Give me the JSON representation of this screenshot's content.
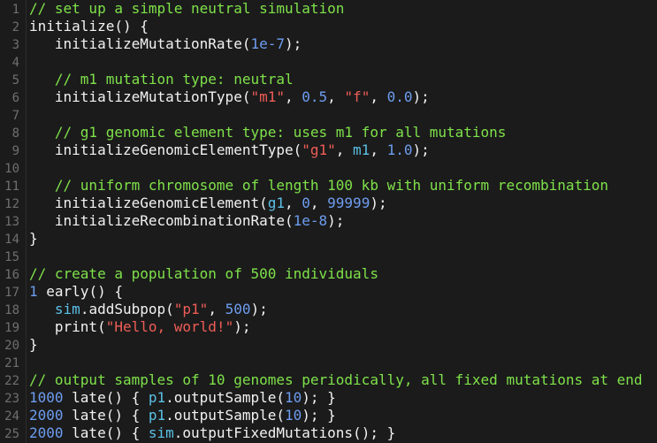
{
  "colors": {
    "background": "#1b1b1b",
    "line_number": "#6f6f6f",
    "plain": "#f2f2f2",
    "comment": "#7fe24a",
    "number": "#6d9df0",
    "string": "#ef5d57",
    "identifier": "#5bc1e6"
  },
  "editor": {
    "lines": [
      {
        "n": "1",
        "tokens": [
          {
            "t": "comment",
            "v": "// set up a simple neutral simulation"
          }
        ]
      },
      {
        "n": "2",
        "tokens": [
          {
            "t": "plain",
            "v": "initialize() {"
          }
        ]
      },
      {
        "n": "3",
        "tokens": [
          {
            "t": "plain",
            "v": "   initializeMutationRate("
          },
          {
            "t": "number",
            "v": "1e-7"
          },
          {
            "t": "plain",
            "v": ");"
          }
        ]
      },
      {
        "n": "4",
        "tokens": []
      },
      {
        "n": "5",
        "tokens": [
          {
            "t": "comment",
            "v": "   // m1 mutation type: neutral"
          }
        ]
      },
      {
        "n": "6",
        "tokens": [
          {
            "t": "plain",
            "v": "   initializeMutationType("
          },
          {
            "t": "string",
            "v": "\"m1\""
          },
          {
            "t": "plain",
            "v": ", "
          },
          {
            "t": "number",
            "v": "0.5"
          },
          {
            "t": "plain",
            "v": ", "
          },
          {
            "t": "string",
            "v": "\"f\""
          },
          {
            "t": "plain",
            "v": ", "
          },
          {
            "t": "number",
            "v": "0.0"
          },
          {
            "t": "plain",
            "v": ");"
          }
        ]
      },
      {
        "n": "7",
        "tokens": []
      },
      {
        "n": "8",
        "tokens": [
          {
            "t": "comment",
            "v": "   // g1 genomic element type: uses m1 for all mutations"
          }
        ]
      },
      {
        "n": "9",
        "tokens": [
          {
            "t": "plain",
            "v": "   initializeGenomicElementType("
          },
          {
            "t": "string",
            "v": "\"g1\""
          },
          {
            "t": "plain",
            "v": ", "
          },
          {
            "t": "ident",
            "v": "m1"
          },
          {
            "t": "plain",
            "v": ", "
          },
          {
            "t": "number",
            "v": "1.0"
          },
          {
            "t": "plain",
            "v": ");"
          }
        ]
      },
      {
        "n": "10",
        "tokens": []
      },
      {
        "n": "11",
        "tokens": [
          {
            "t": "comment",
            "v": "   // uniform chromosome of length 100 kb with uniform recombination"
          }
        ]
      },
      {
        "n": "12",
        "tokens": [
          {
            "t": "plain",
            "v": "   initializeGenomicElement("
          },
          {
            "t": "ident",
            "v": "g1"
          },
          {
            "t": "plain",
            "v": ", "
          },
          {
            "t": "number",
            "v": "0"
          },
          {
            "t": "plain",
            "v": ", "
          },
          {
            "t": "number",
            "v": "99999"
          },
          {
            "t": "plain",
            "v": ");"
          }
        ]
      },
      {
        "n": "13",
        "tokens": [
          {
            "t": "plain",
            "v": "   initializeRecombinationRate("
          },
          {
            "t": "number",
            "v": "1e-8"
          },
          {
            "t": "plain",
            "v": ");"
          }
        ]
      },
      {
        "n": "14",
        "tokens": [
          {
            "t": "plain",
            "v": "}"
          }
        ]
      },
      {
        "n": "15",
        "tokens": []
      },
      {
        "n": "16",
        "tokens": [
          {
            "t": "comment",
            "v": "// create a population of 500 individuals"
          }
        ]
      },
      {
        "n": "17",
        "tokens": [
          {
            "t": "number",
            "v": "1"
          },
          {
            "t": "plain",
            "v": " early() {"
          }
        ]
      },
      {
        "n": "18",
        "tokens": [
          {
            "t": "plain",
            "v": "   "
          },
          {
            "t": "ident",
            "v": "sim"
          },
          {
            "t": "plain",
            "v": ".addSubpop("
          },
          {
            "t": "string",
            "v": "\"p1\""
          },
          {
            "t": "plain",
            "v": ", "
          },
          {
            "t": "number",
            "v": "500"
          },
          {
            "t": "plain",
            "v": ");"
          }
        ]
      },
      {
        "n": "19",
        "tokens": [
          {
            "t": "plain",
            "v": "   print("
          },
          {
            "t": "string",
            "v": "\"Hello, world!\""
          },
          {
            "t": "plain",
            "v": ");"
          }
        ]
      },
      {
        "n": "20",
        "tokens": [
          {
            "t": "plain",
            "v": "}"
          }
        ]
      },
      {
        "n": "21",
        "tokens": []
      },
      {
        "n": "22",
        "tokens": [
          {
            "t": "comment",
            "v": "// output samples of 10 genomes periodically, all fixed mutations at end"
          }
        ]
      },
      {
        "n": "23",
        "tokens": [
          {
            "t": "number",
            "v": "1000"
          },
          {
            "t": "plain",
            "v": " late() { "
          },
          {
            "t": "ident",
            "v": "p1"
          },
          {
            "t": "plain",
            "v": ".outputSample("
          },
          {
            "t": "number",
            "v": "10"
          },
          {
            "t": "plain",
            "v": "); }"
          }
        ]
      },
      {
        "n": "24",
        "tokens": [
          {
            "t": "number",
            "v": "2000"
          },
          {
            "t": "plain",
            "v": " late() { "
          },
          {
            "t": "ident",
            "v": "p1"
          },
          {
            "t": "plain",
            "v": ".outputSample("
          },
          {
            "t": "number",
            "v": "10"
          },
          {
            "t": "plain",
            "v": "); }"
          }
        ]
      },
      {
        "n": "25",
        "tokens": [
          {
            "t": "number",
            "v": "2000"
          },
          {
            "t": "plain",
            "v": " late() { "
          },
          {
            "t": "ident",
            "v": "sim"
          },
          {
            "t": "plain",
            "v": ".outputFixedMutations(); }"
          }
        ]
      }
    ]
  }
}
